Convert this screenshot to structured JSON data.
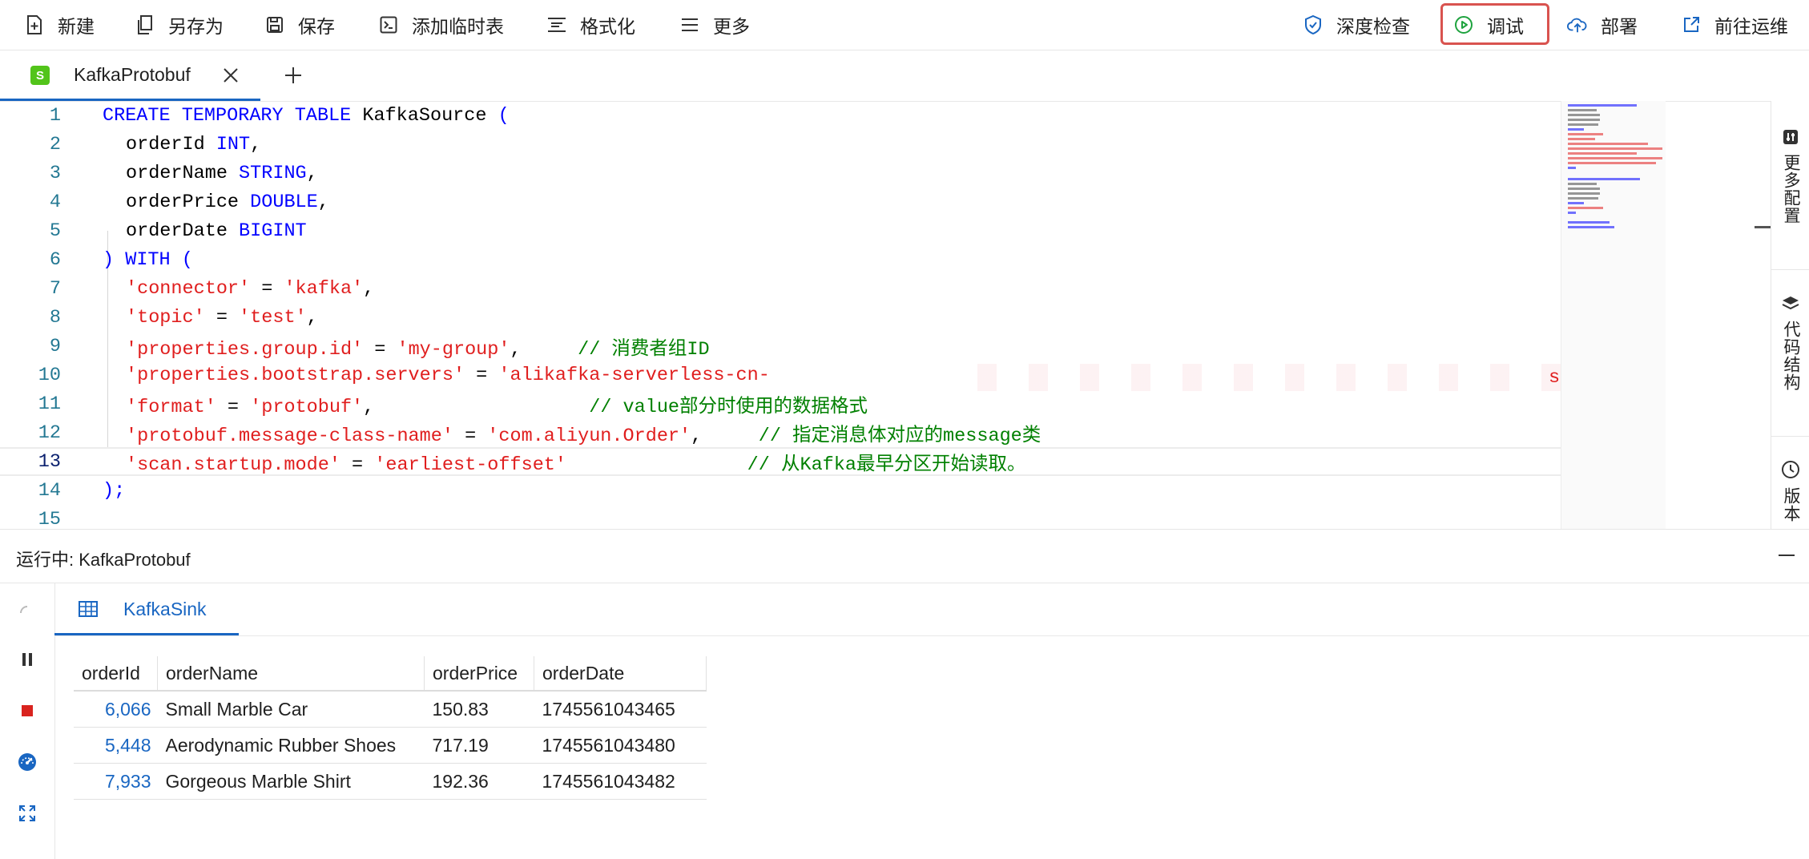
{
  "toolbar": {
    "new": "新建",
    "save_as": "另存为",
    "save": "保存",
    "add_temp_table": "添加临时表",
    "format": "格式化",
    "more": "更多",
    "deep_check": "深度检查",
    "debug": "调试",
    "deploy": "部署",
    "go_ops": "前往运维"
  },
  "tab": {
    "badge": "S",
    "title": "KafkaProtobuf"
  },
  "editor": {
    "lines": [
      {
        "n": "1"
      },
      {
        "n": "2"
      },
      {
        "n": "3"
      },
      {
        "n": "4"
      },
      {
        "n": "5"
      },
      {
        "n": "6"
      },
      {
        "n": "7"
      },
      {
        "n": "8"
      },
      {
        "n": "9"
      },
      {
        "n": "10"
      },
      {
        "n": "11"
      },
      {
        "n": "12"
      },
      {
        "n": "13"
      },
      {
        "n": "14"
      },
      {
        "n": "15"
      }
    ],
    "code": {
      "l1": {
        "k1": "CREATE TEMPORARY TABLE",
        "n": " KafkaSource ",
        "p": "("
      },
      "l2": {
        "a": "orderId ",
        "t": "INT",
        "c": ","
      },
      "l3": {
        "a": "orderName ",
        "t": "STRING",
        "c": ","
      },
      "l4": {
        "a": "orderPrice ",
        "t": "DOUBLE",
        "c": ","
      },
      "l5": {
        "a": "orderDate ",
        "t": "BIGINT"
      },
      "l6": {
        "a": ") ",
        "t": "WITH",
        "b": " ("
      },
      "l7": {
        "k": "'connector'",
        "eq": " = ",
        "v": "'kafka'",
        "c": ","
      },
      "l8": {
        "k": "'topic'",
        "eq": " = ",
        "v": "'test'",
        "c": ","
      },
      "l9": {
        "k": "'properties.group.id'",
        "eq": " = ",
        "v": "'my-group'",
        "c": ",     ",
        "cm": "// 消费者组ID"
      },
      "l10": {
        "k": "'properties.bootstrap.servers'",
        "eq": " = ",
        "v": "'alikafka-serverless-cn-",
        "tail": "s"
      },
      "l11": {
        "k": "'format'",
        "eq": " = ",
        "v": "'protobuf'",
        "c": ",                   ",
        "cm": "// value部分时使用的数据格式"
      },
      "l12": {
        "k": "'protobuf.message-class-name'",
        "eq": " = ",
        "v": "'com.aliyun.Order'",
        "c": ",     ",
        "cm": "// 指定消息体对应的message类"
      },
      "l13": {
        "k": "'scan.startup.mode'",
        "eq": " = ",
        "v": "'earliest-offset'",
        "sp": "                ",
        "cm": "// 从Kafka最早分区开始读取。"
      },
      "l14": {
        "a": ");"
      }
    }
  },
  "sidebar": {
    "more_config": "更多配置",
    "code_structure": "代码结构",
    "version": "版本"
  },
  "run": {
    "title": "运行中: KafkaProtobuf",
    "result_tab": "KafkaSink",
    "columns": [
      "orderId",
      "orderName",
      "orderPrice",
      "orderDate"
    ],
    "rows": [
      {
        "orderId": "6,066",
        "orderName": "Small Marble Car",
        "orderPrice": "150.83",
        "orderDate": "1745561043465"
      },
      {
        "orderId": "5,448",
        "orderName": "Aerodynamic Rubber Shoes",
        "orderPrice": "717.19",
        "orderDate": "1745561043480"
      },
      {
        "orderId": "7,933",
        "orderName": "Gorgeous Marble Shirt",
        "orderPrice": "192.36",
        "orderDate": "1745561043482"
      }
    ]
  },
  "colors": {
    "accent": "#1966c2",
    "keyword": "#0000ff",
    "string": "#e01e1e",
    "comment": "#008000",
    "highlight_border": "#d9534f"
  }
}
